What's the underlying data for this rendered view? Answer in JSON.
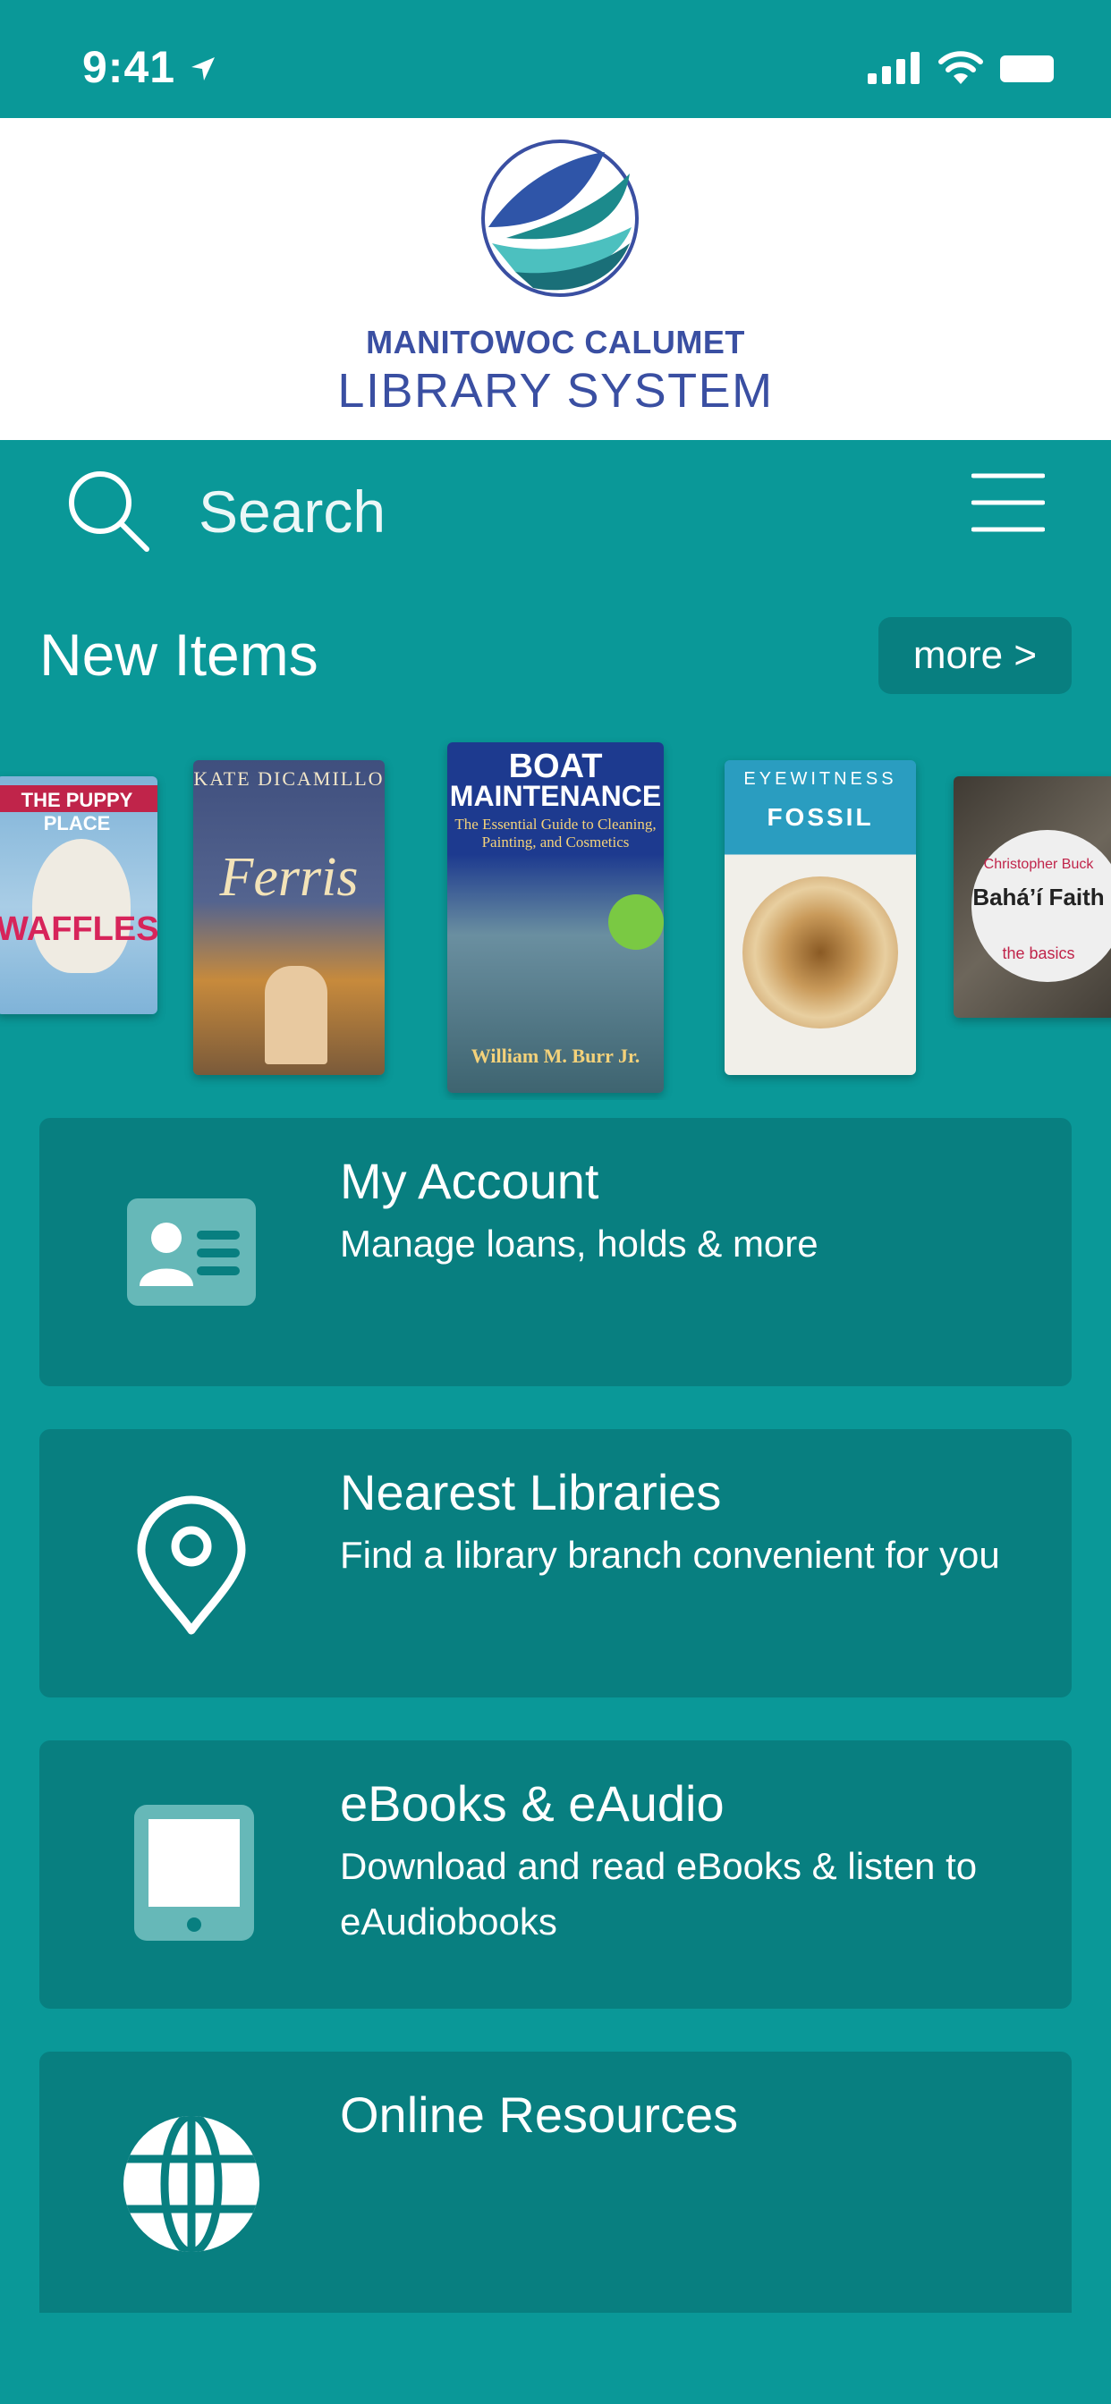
{
  "status_bar": {
    "time": "9:41"
  },
  "logo": {
    "line1": "MANITOWOC CALUMET",
    "line2": "LIBRARY SYSTEM"
  },
  "search": {
    "placeholder": "Search"
  },
  "new_items": {
    "title": "New Items",
    "more_label": "more >",
    "books": [
      {
        "line1": "THE PUPPY PLACE",
        "line2": "WAFFLES",
        "colors": [
          "#7fb3d8",
          "#e8e4da"
        ]
      },
      {
        "line1": "KATE DICAMILLO",
        "line2": "Ferris",
        "colors": [
          "#4a5a8a",
          "#c78a3c"
        ]
      },
      {
        "line1": "BOAT",
        "line2": "MAINTENANCE",
        "line3": "The Essential Guide to Cleaning, Painting, and Cosmetics",
        "line4": "William M. Burr Jr.",
        "colors": [
          "#1d3a8f",
          "#6a8fa0"
        ]
      },
      {
        "line1": "EYEWITNESS",
        "line2": "FOSSIL",
        "colors": [
          "#2a9dc0",
          "#d9c7a2"
        ]
      },
      {
        "line1": "Christopher Buck",
        "line2": "Bahá’í Faith",
        "line3": "the basics",
        "colors": [
          "#5a554d",
          "#dedede"
        ]
      }
    ]
  },
  "cards": [
    {
      "title": "My Account",
      "description": "Manage loans, holds & more",
      "icon": "id-card-icon"
    },
    {
      "title": "Nearest Libraries",
      "description": "Find a library branch convenient for you",
      "icon": "location-pin-icon"
    },
    {
      "title": "eBooks & eAudio",
      "description": "Download and read eBooks & listen to eAudiobooks",
      "icon": "tablet-icon"
    },
    {
      "title": "Online Resources",
      "description": "",
      "icon": "globe-icon"
    }
  ],
  "colors": {
    "background": "#0a9898",
    "card": "#087f80",
    "logo_blue": "#3a4fa2"
  }
}
